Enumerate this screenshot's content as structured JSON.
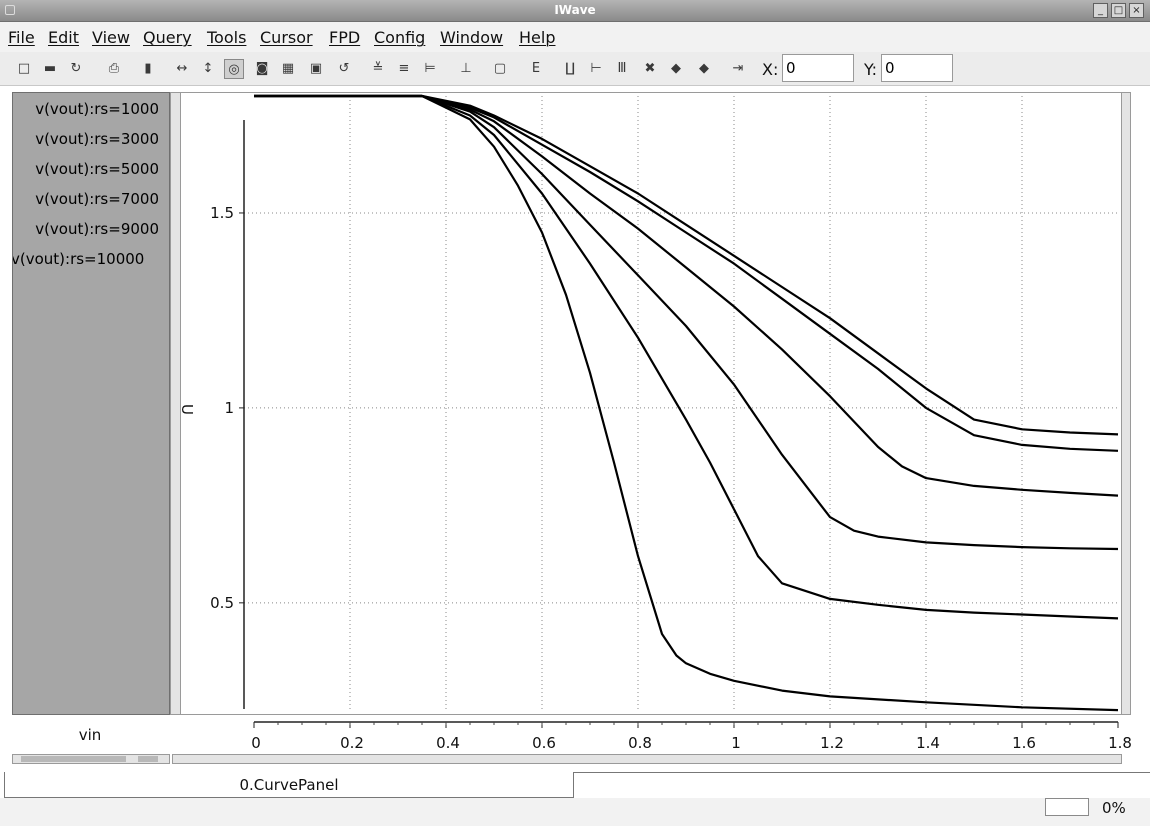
{
  "window": {
    "title": "IWave"
  },
  "menu": [
    "File",
    "Edit",
    "View",
    "Query",
    "Tools",
    "Cursor",
    "FPD",
    "Config",
    "Window",
    "Help"
  ],
  "toolbar": {
    "icons": [
      "new-icon",
      "open-icon",
      "refresh-icon",
      "print-icon",
      "delete-icon",
      "zoom-x-icon",
      "zoom-y-icon",
      "zoom-box-icon",
      "zoom-fit-icon",
      "grid-icon",
      "zoom-reset-icon",
      "redraw-icon",
      "xy-plot-icon",
      "time-plot-icon",
      "range-plot-icon",
      "measure-icon",
      "annotate-icon",
      "function-icon",
      "axis-lines-icon",
      "axis-corner-icon",
      "bars-icon",
      "remove-cursor-icon",
      "previous-icon",
      "next-icon",
      "export-icon"
    ],
    "x_label": "X:",
    "x_value": "0",
    "y_label": "Y:",
    "y_value": "0"
  },
  "legend": {
    "items": [
      "v(vout):rs=1000",
      "v(vout):rs=3000",
      "v(vout):rs=5000",
      "v(vout):rs=7000",
      "v(vout):rs=9000",
      "v(vout):rs=10000"
    ]
  },
  "chart_data": {
    "type": "line",
    "xlabel": "vin",
    "ylabel": "U",
    "xlim": [
      0,
      1.8
    ],
    "ylim": [
      0.22,
      1.8
    ],
    "x_ticks": [
      "0",
      "0.2",
      "0.4",
      "0.6",
      "0.8",
      "1",
      "1.2",
      "1.4",
      "1.6",
      "1.8"
    ],
    "y_ticks": [
      "0.5",
      "1",
      "1.5"
    ],
    "grid": true,
    "legend_position": "left-panel",
    "series": [
      {
        "name": "v(vout):rs=1000",
        "x": [
          0,
          0.35,
          0.45,
          0.5,
          0.6,
          0.7,
          0.8,
          0.9,
          1.0,
          1.1,
          1.2,
          1.3,
          1.4,
          1.5,
          1.6,
          1.7,
          1.8
        ],
        "y": [
          1.8,
          1.8,
          1.775,
          1.75,
          1.69,
          1.62,
          1.55,
          1.47,
          1.39,
          1.31,
          1.23,
          1.14,
          1.05,
          0.97,
          0.945,
          0.937,
          0.932
        ]
      },
      {
        "name": "v(vout):rs=3000",
        "x": [
          0,
          0.35,
          0.45,
          0.5,
          0.6,
          0.7,
          0.8,
          0.9,
          1.0,
          1.1,
          1.2,
          1.3,
          1.4,
          1.5,
          1.6,
          1.7,
          1.8
        ],
        "y": [
          1.8,
          1.8,
          1.77,
          1.745,
          1.675,
          1.605,
          1.53,
          1.45,
          1.37,
          1.28,
          1.19,
          1.1,
          1.0,
          0.93,
          0.905,
          0.895,
          0.89
        ]
      },
      {
        "name": "v(vout):rs=5000",
        "x": [
          0,
          0.35,
          0.45,
          0.5,
          0.6,
          0.7,
          0.8,
          0.9,
          1.0,
          1.1,
          1.2,
          1.3,
          1.35,
          1.4,
          1.5,
          1.6,
          1.7,
          1.8
        ],
        "y": [
          1.8,
          1.8,
          1.765,
          1.735,
          1.645,
          1.55,
          1.46,
          1.36,
          1.26,
          1.15,
          1.03,
          0.9,
          0.85,
          0.82,
          0.8,
          0.79,
          0.782,
          0.775
        ]
      },
      {
        "name": "v(vout):rs=7000",
        "x": [
          0,
          0.35,
          0.45,
          0.5,
          0.6,
          0.7,
          0.8,
          0.9,
          1.0,
          1.1,
          1.2,
          1.25,
          1.3,
          1.4,
          1.5,
          1.6,
          1.7,
          1.8
        ],
        "y": [
          1.8,
          1.8,
          1.76,
          1.72,
          1.6,
          1.47,
          1.34,
          1.21,
          1.06,
          0.88,
          0.72,
          0.685,
          0.67,
          0.655,
          0.648,
          0.643,
          0.64,
          0.638
        ]
      },
      {
        "name": "v(vout):rs=9000",
        "x": [
          0,
          0.35,
          0.45,
          0.5,
          0.6,
          0.7,
          0.8,
          0.9,
          0.95,
          1.0,
          1.05,
          1.1,
          1.2,
          1.3,
          1.4,
          1.5,
          1.6,
          1.7,
          1.8
        ],
        "y": [
          1.8,
          1.8,
          1.75,
          1.7,
          1.55,
          1.37,
          1.18,
          0.97,
          0.86,
          0.74,
          0.62,
          0.55,
          0.51,
          0.495,
          0.482,
          0.475,
          0.47,
          0.465,
          0.46
        ]
      },
      {
        "name": "v(vout):rs=10000",
        "x": [
          0,
          0.35,
          0.45,
          0.5,
          0.55,
          0.6,
          0.65,
          0.7,
          0.75,
          0.8,
          0.85,
          0.88,
          0.9,
          0.95,
          1.0,
          1.1,
          1.2,
          1.4,
          1.6,
          1.8
        ],
        "y": [
          1.8,
          1.8,
          1.74,
          1.67,
          1.57,
          1.45,
          1.29,
          1.09,
          0.86,
          0.62,
          0.42,
          0.365,
          0.345,
          0.318,
          0.3,
          0.275,
          0.26,
          0.245,
          0.232,
          0.225
        ]
      }
    ]
  },
  "tabs": [
    {
      "label": "0.CurvePanel"
    }
  ],
  "status": {
    "progress_text": "0%",
    "progress_fraction": 0
  }
}
